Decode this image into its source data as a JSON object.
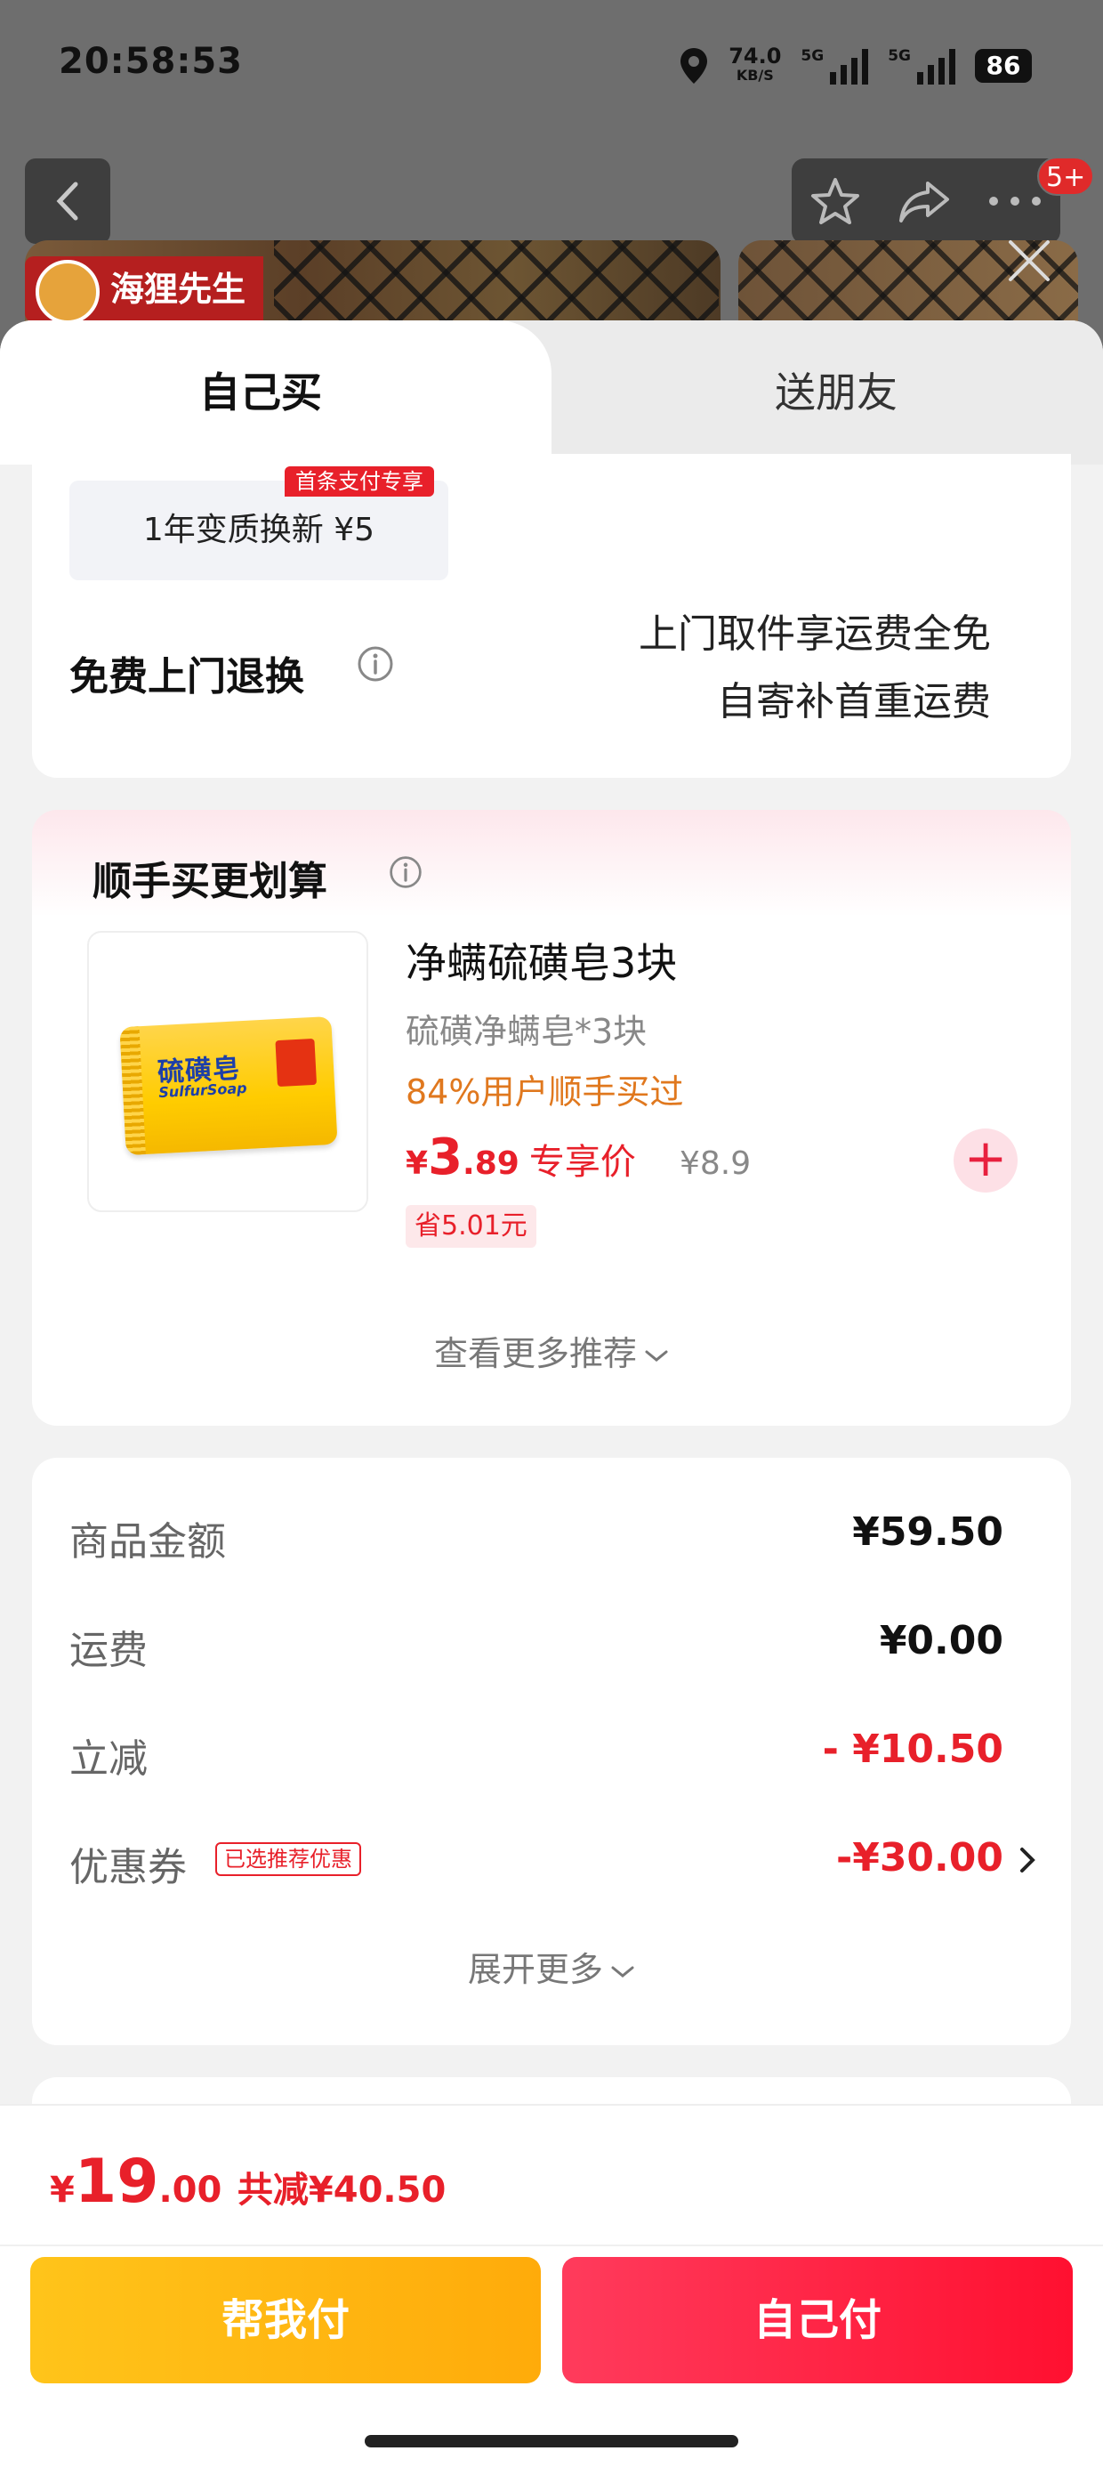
{
  "status_bar": {
    "time": "20:58:53",
    "net_speed": "74.0",
    "net_unit": "KB/S",
    "sig1_tag": "5G",
    "sig2_tag": "5G",
    "battery": "86"
  },
  "header": {
    "badge": "5+",
    "brand": "海狸先生"
  },
  "tabs": {
    "self": "自己买",
    "friend": "送朋友"
  },
  "service": {
    "option_label": "1年变质换新 ¥5",
    "option_tag": "首条支付专享",
    "return_title": "免费上门退换",
    "return_line1": "上门取件享运费全免",
    "return_line2": "自寄补首重运费"
  },
  "upsell": {
    "title": "顺手买更划算",
    "product_name": "净螨硫磺皂3块",
    "product_spec": "硫磺净螨皂*3块",
    "product_stat": "84%用户顺手买过",
    "price_symbol": "¥",
    "price_int": "3",
    "price_dec": ".89",
    "price_tag": "专享价",
    "price_orig": "¥8.9",
    "save": "省5.01元",
    "soap_label": "硫磺皂",
    "soap_sub": "SulfurSoap",
    "add": "+",
    "more": "查看更多推荐"
  },
  "summary": {
    "rows": [
      {
        "label": "商品金额",
        "value": "¥59.50"
      },
      {
        "label": "运费",
        "value": "¥0.00"
      },
      {
        "label": "立减",
        "value": "- ¥10.50"
      },
      {
        "label": "优惠券",
        "value": "-¥30.00",
        "tag": "已选推荐优惠"
      }
    ],
    "expand": "展开更多"
  },
  "checkout": {
    "symbol": "¥",
    "int": "19",
    "dec": ".00",
    "saved": "共减¥40.50",
    "help_pay": "帮我付",
    "self_pay": "自己付"
  },
  "colors": {
    "accent_red": "#e8202a",
    "help_btn": "#ffb412",
    "pay_btn": "#ff2140"
  }
}
